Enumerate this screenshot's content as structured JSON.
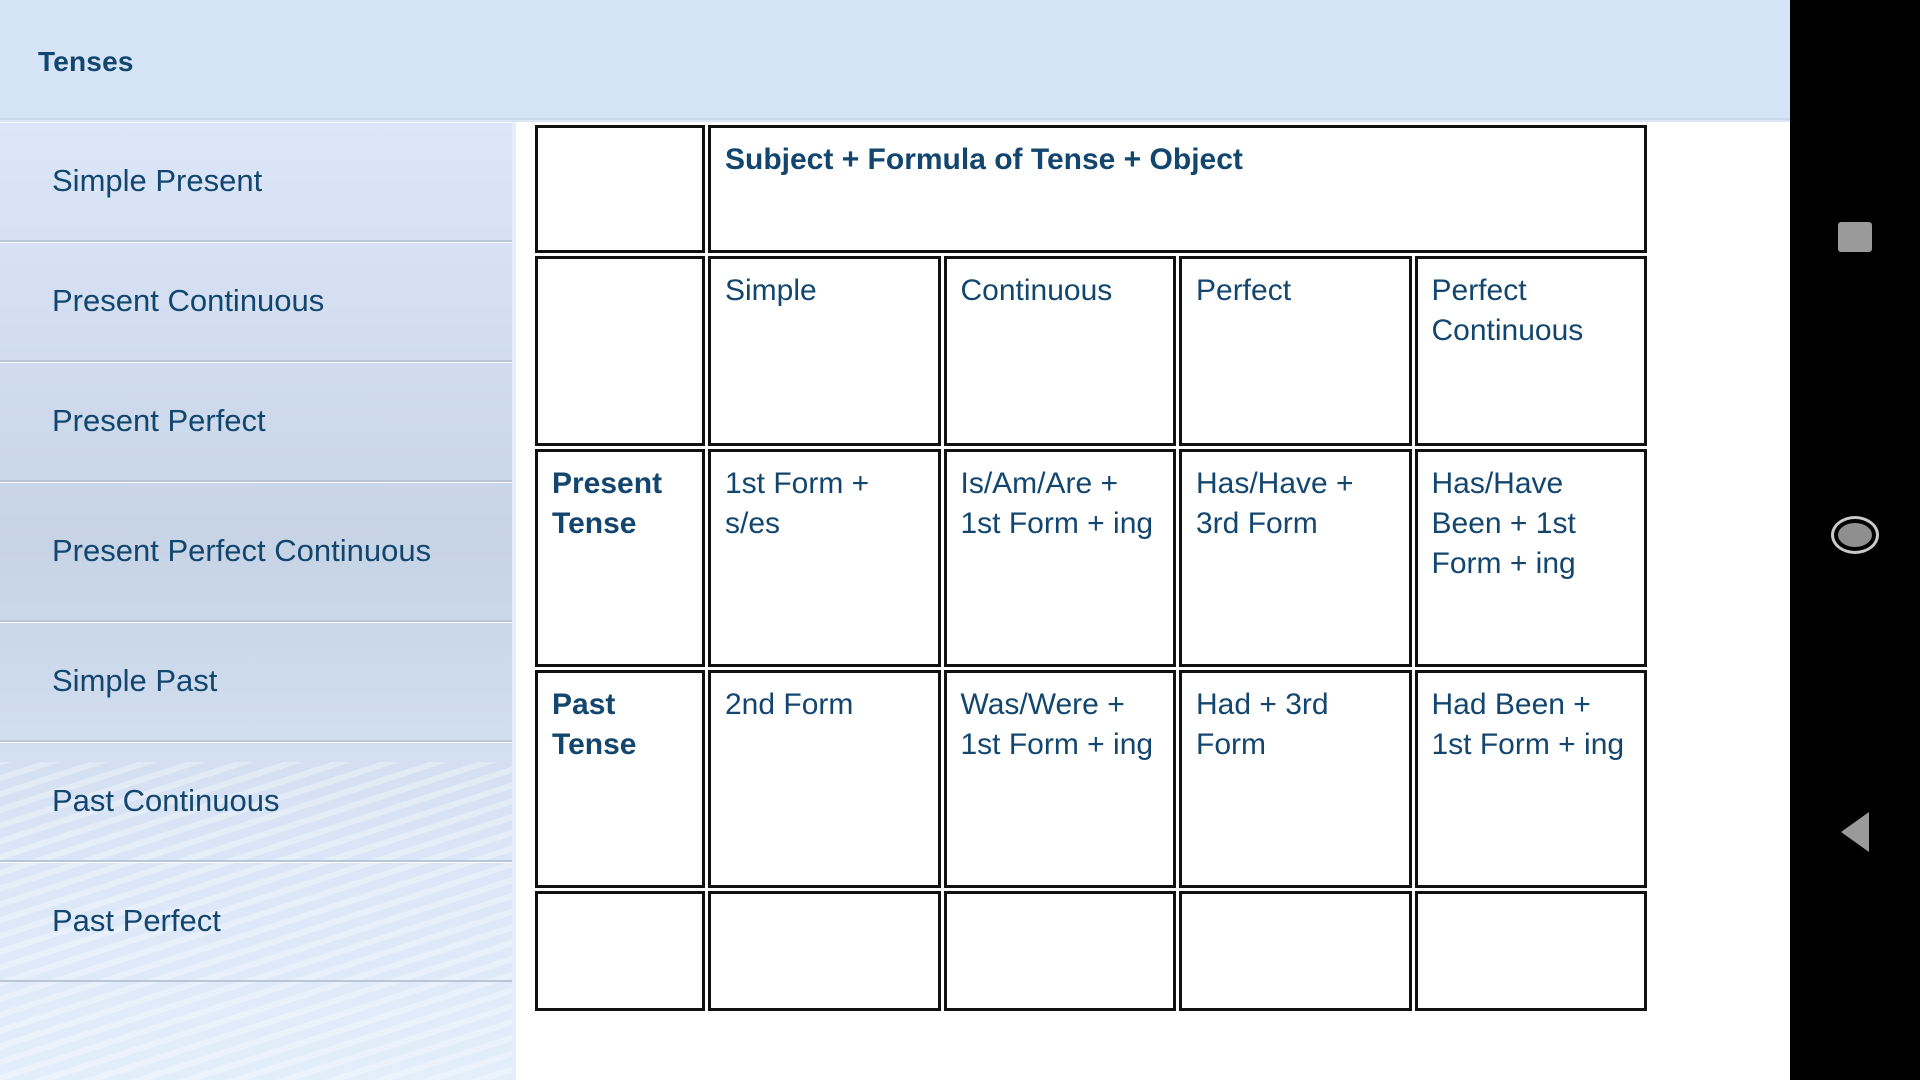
{
  "app": {
    "title": "Tenses",
    "accent_color": "#13466e",
    "titlebar_bg": "#d6e4f7",
    "sidebar_bg": "#cfdcef",
    "content_bg": "#ffffff",
    "navbar_bg": "#000000"
  },
  "sidebar": {
    "items": [
      {
        "label": "Simple Present"
      },
      {
        "label": "Present Continuous"
      },
      {
        "label": "Present Perfect"
      },
      {
        "label": "Present Perfect Continuous"
      },
      {
        "label": "Simple Past"
      },
      {
        "label": "Past Continuous"
      },
      {
        "label": "Past Perfect"
      }
    ]
  },
  "table": {
    "banner": "Subject + Formula of Tense + Object",
    "column_headers": [
      "",
      "Simple",
      "Continuous",
      "Perfect",
      "Perfect Continuous"
    ],
    "rows": [
      {
        "header": "Present Tense",
        "cells": [
          "1st Form + s/es",
          "Is/Am/Are + 1st Form + ing",
          "Has/Have + 3rd Form",
          "Has/Have Been + 1st Form + ing"
        ]
      },
      {
        "header": "Past Tense",
        "cells": [
          "2nd Form",
          "Was/Were + 1st Form + ing",
          "Had + 3rd Form",
          "Had Been + 1st Form + ing"
        ]
      }
    ]
  },
  "navbar": {
    "recent_label": "recent-apps",
    "home_label": "home",
    "back_label": "back"
  }
}
